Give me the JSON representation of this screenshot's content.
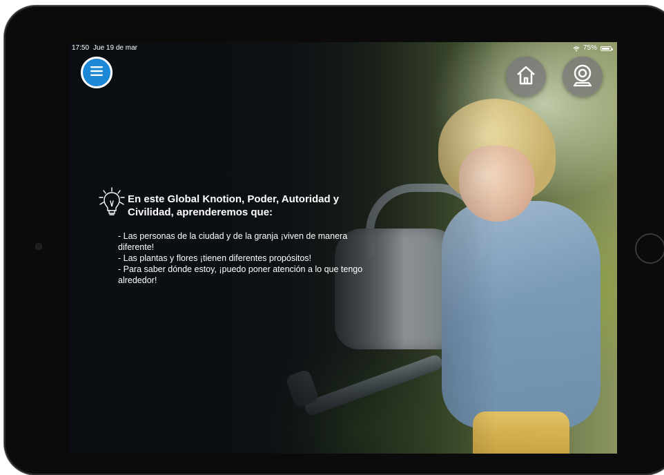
{
  "status_bar": {
    "time": "17:50",
    "date": "Jue 19 de mar",
    "battery": "75%"
  },
  "nav": {
    "menu_icon": "hamburger-menu-icon",
    "home_icon": "home-icon",
    "webcam_icon": "webcam-icon"
  },
  "content": {
    "icon": "lightbulb-idea-icon",
    "heading": "En este Global Knotion, Poder, Autoridad y Civilidad, aprenderemos que:",
    "bullets": [
      "- Las personas de la ciudad y de la granja ¡viven de manera diferente!",
      "- Las plantas y flores ¡tienen diferentes propósitos!",
      "- Para saber dónde estoy, ¡puedo poner atención a lo que tengo alrededor!"
    ]
  },
  "colors": {
    "menu_button": "#1d88d6",
    "overlay_button": "#787878",
    "text": "#ffffff"
  }
}
